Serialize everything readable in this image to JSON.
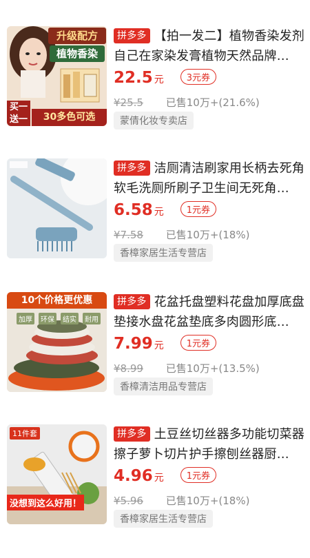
{
  "products": [
    {
      "image_caption_top": "升级配方",
      "image_caption_mid": "植物香染",
      "image_caption_bottom": "30多色可选",
      "image_caption_side": "买一送一",
      "platform_badge": "拼多多",
      "title": "【拍一发二】植物香染发剂自己在家染发膏植物天然品牌…",
      "price": "22.5",
      "currency_unit": "元",
      "coupon": "3元券",
      "original_price": "¥25.5",
      "sold": "已售10万+(21.6%)",
      "shop": "蒙倩化妆专卖店"
    },
    {
      "image_caption_top": "",
      "platform_badge": "拼多多",
      "title": "洁厕清洁刷家用长柄去死角软毛洗厕所刷子卫生间无死角…",
      "price": "6.58",
      "currency_unit": "元",
      "coupon": "1元券",
      "original_price": "¥7.58",
      "sold": "已售10万+(18%)",
      "shop": "香樟家居生活专营店"
    },
    {
      "image_caption_top": "10个价格更优惠",
      "image_tags": [
        "加厚",
        "环保",
        "结实",
        "耐用"
      ],
      "platform_badge": "拼多多",
      "title": "花盆托盘塑料花盘加厚底盘垫接水盘花盆垫底多肉圆形底…",
      "price": "7.99",
      "currency_unit": "元",
      "coupon": "1元券",
      "original_price": "¥8.99",
      "sold": "已售10万+(13.5%)",
      "shop": "香樟清洁用品专营店"
    },
    {
      "image_caption_top": "11件套",
      "image_caption_bottom": "没想到这么好用！",
      "platform_badge": "拼多多",
      "title": "土豆丝切丝器多功能切菜器擦子萝卜切片护手擦刨丝器厨…",
      "price": "4.96",
      "currency_unit": "元",
      "coupon": "1元券",
      "original_price": "¥5.96",
      "sold": "已售10万+(18%)",
      "shop": "香樟家居生活专营店"
    }
  ],
  "colors": {
    "accent": "#e02e24",
    "muted": "#888888",
    "shop_bg": "#f1f1f1"
  }
}
